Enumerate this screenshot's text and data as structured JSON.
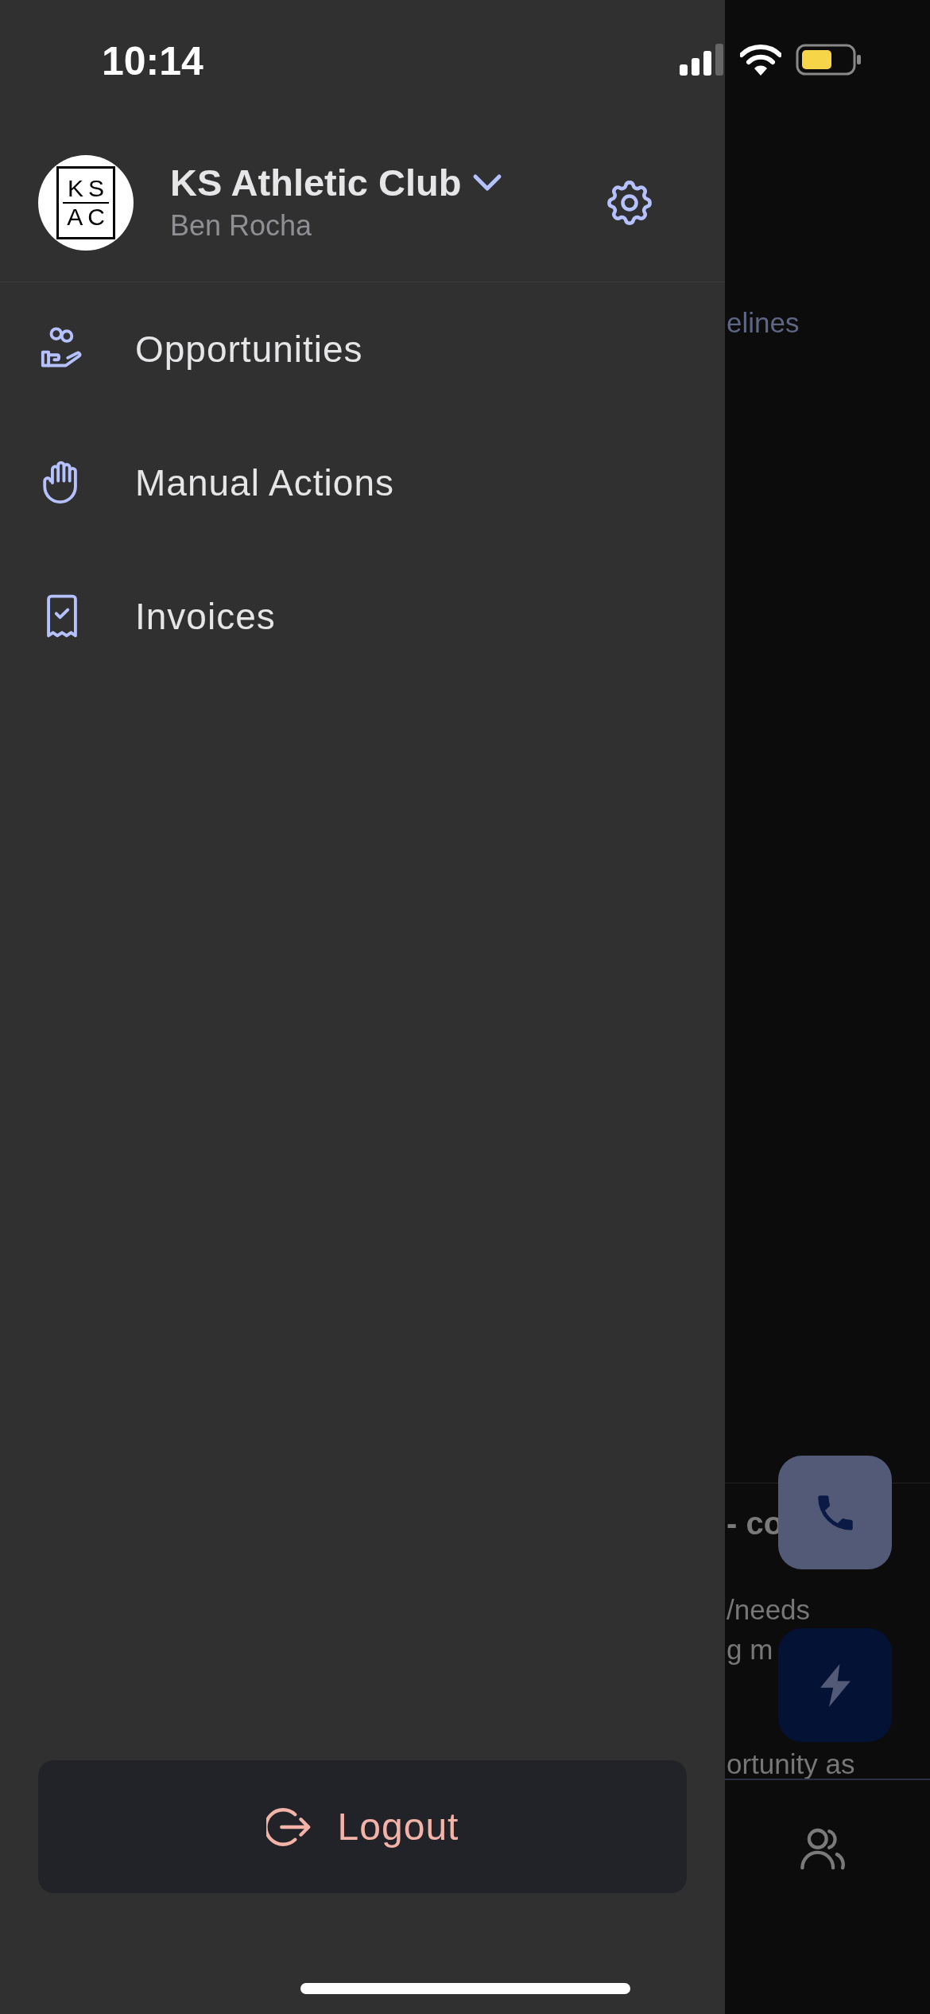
{
  "status_bar": {
    "time": "10:14"
  },
  "account": {
    "club": "KS Athletic Club",
    "user": "Ben Rocha",
    "logo_lines": [
      "KS",
      "AC"
    ]
  },
  "menu": [
    {
      "label": "Opportunities",
      "kind": "opportunities"
    },
    {
      "label": "Manual Actions",
      "kind": "manual"
    },
    {
      "label": "Invoices",
      "kind": "invoices"
    }
  ],
  "logout": {
    "label": "Logout"
  },
  "background": {
    "texts": [
      {
        "text": "elines",
        "kind": "link"
      },
      {
        "text": "- co",
        "kind": "heading"
      },
      {
        "text": "/needs",
        "kind": "body"
      },
      {
        "text": "g m",
        "kind": "body"
      },
      {
        "text": "ortunity as",
        "kind": "body"
      }
    ]
  }
}
